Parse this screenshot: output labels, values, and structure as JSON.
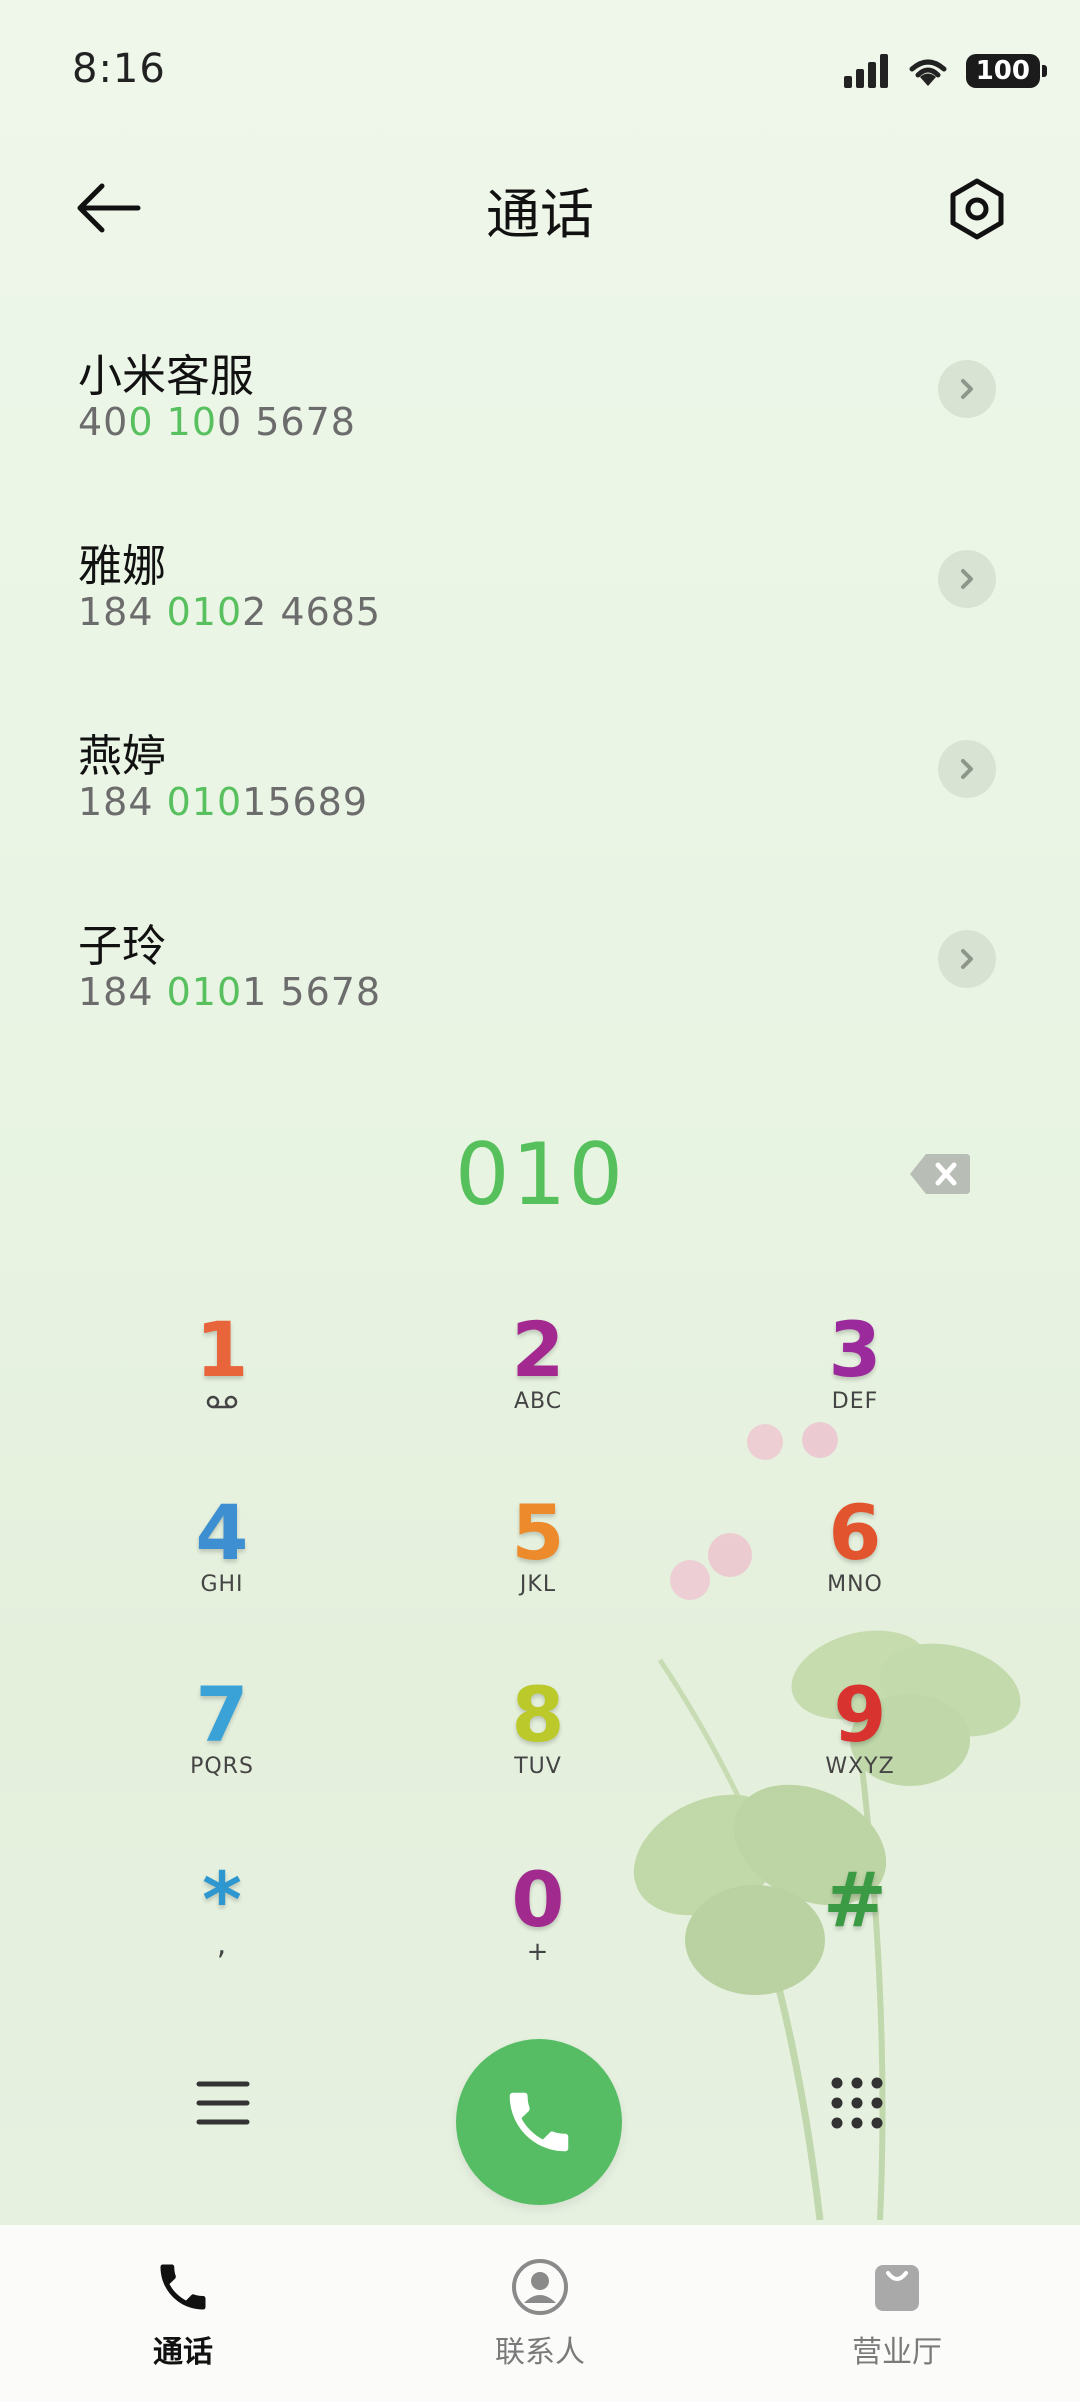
{
  "status_bar": {
    "time": "8:16",
    "battery": "100"
  },
  "header": {
    "title": "通话"
  },
  "results": [
    {
      "name": "小米客服",
      "number_parts": [
        "40",
        "0",
        " ",
        "10",
        "0 5678"
      ]
    },
    {
      "name": "雅娜",
      "number_parts": [
        "184 ",
        "010",
        "2 4685"
      ]
    },
    {
      "name": "燕婷",
      "number_parts": [
        "184 ",
        "010",
        "15689"
      ]
    },
    {
      "name": "子玲",
      "number_parts": [
        "184 ",
        "010",
        "1 5678"
      ]
    }
  ],
  "dialed_number": "010",
  "keypad": [
    {
      "digit": "1",
      "letters": "",
      "color": "#e8643a"
    },
    {
      "digit": "2",
      "letters": "ABC",
      "color": "#a3288f"
    },
    {
      "digit": "3",
      "letters": "DEF",
      "color": "#9b2a9c"
    },
    {
      "digit": "4",
      "letters": "GHI",
      "color": "#3d8fd1"
    },
    {
      "digit": "5",
      "letters": "JKL",
      "color": "#ec8a2c"
    },
    {
      "digit": "6",
      "letters": "MNO",
      "color": "#e2542d"
    },
    {
      "digit": "7",
      "letters": "PQRS",
      "color": "#3ba2d8"
    },
    {
      "digit": "8",
      "letters": "TUV",
      "color": "#bcc92a"
    },
    {
      "digit": "9",
      "letters": "WXYZ",
      "color": "#d8332e"
    },
    {
      "digit": "*",
      "letters": ",",
      "color": "#2f97cf"
    },
    {
      "digit": "0",
      "letters": "+",
      "color": "#a02a8e"
    },
    {
      "digit": "#",
      "letters": "",
      "color": "#3b9a44"
    }
  ],
  "tabs": [
    {
      "label": "通话",
      "icon": "phone-icon",
      "active": true
    },
    {
      "label": "联系人",
      "icon": "contact-icon",
      "active": false
    },
    {
      "label": "营业厅",
      "icon": "shopping-bag-icon",
      "active": false
    }
  ],
  "colors": {
    "accent": "#56c15c",
    "call_button": "#56bd64"
  }
}
